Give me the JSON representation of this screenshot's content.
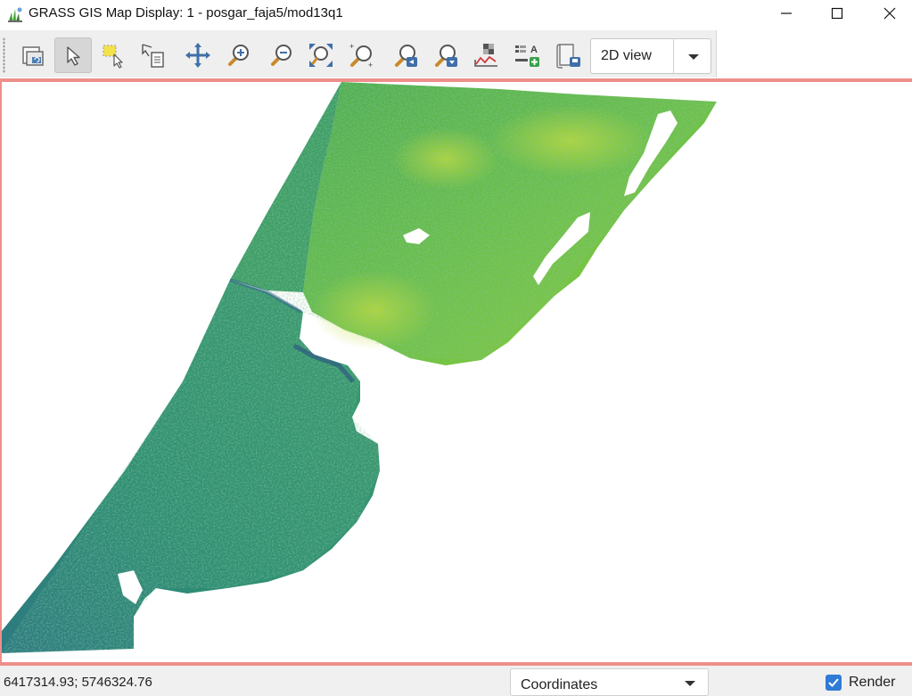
{
  "window": {
    "title": "GRASS GIS Map Display: 1 - posgar_faja5/mod13q1",
    "icon": "grass-gis-app-icon",
    "controls": [
      "minimize-icon",
      "maximize-icon",
      "close-icon"
    ]
  },
  "toolbar": {
    "tools": [
      {
        "name": "display-map-icon",
        "active": false
      },
      {
        "name": "pointer-icon",
        "active": true
      },
      {
        "name": "select-features-icon",
        "active": false
      },
      {
        "name": "query-icon",
        "active": false
      },
      {
        "name": "pan-icon",
        "active": false
      },
      {
        "name": "zoom-in-icon",
        "active": false
      },
      {
        "name": "zoom-out-icon",
        "active": false
      },
      {
        "name": "zoom-extent-icon",
        "active": false
      },
      {
        "name": "zoom-region-icon",
        "active": false
      },
      {
        "name": "zoom-back-icon",
        "active": false
      },
      {
        "name": "zoom-options-icon",
        "active": false
      },
      {
        "name": "analyze-icon",
        "active": false
      },
      {
        "name": "map-decorations-icon",
        "active": false
      },
      {
        "name": "save-display-icon",
        "active": false
      }
    ],
    "view_selector": {
      "value": "2D view"
    }
  },
  "canvas": {
    "layer": "mod13q1",
    "colors": {
      "border": "#ee8f8b",
      "dark": "#2d6b8f",
      "mid": "#2f9a72",
      "light": "#6cc04a",
      "bright": "#b5d83a"
    }
  },
  "statusbar": {
    "coordinates": "6417314.93; 5746324.76",
    "mode_selector": {
      "value": "Coordinates"
    },
    "render": {
      "label": "Render",
      "checked": true
    }
  }
}
